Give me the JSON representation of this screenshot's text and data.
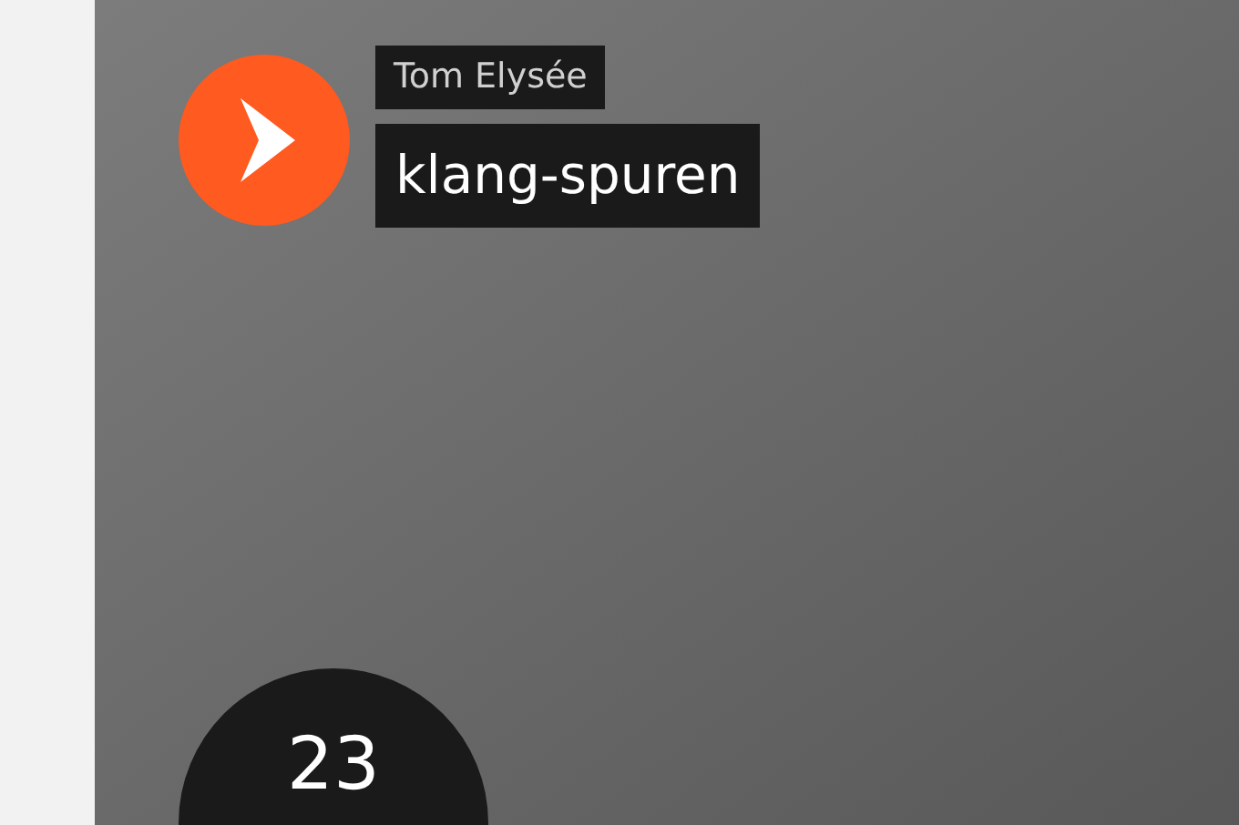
{
  "player": {
    "artist": "Tom Elysée",
    "title": "klang-spuren",
    "count": "23"
  }
}
